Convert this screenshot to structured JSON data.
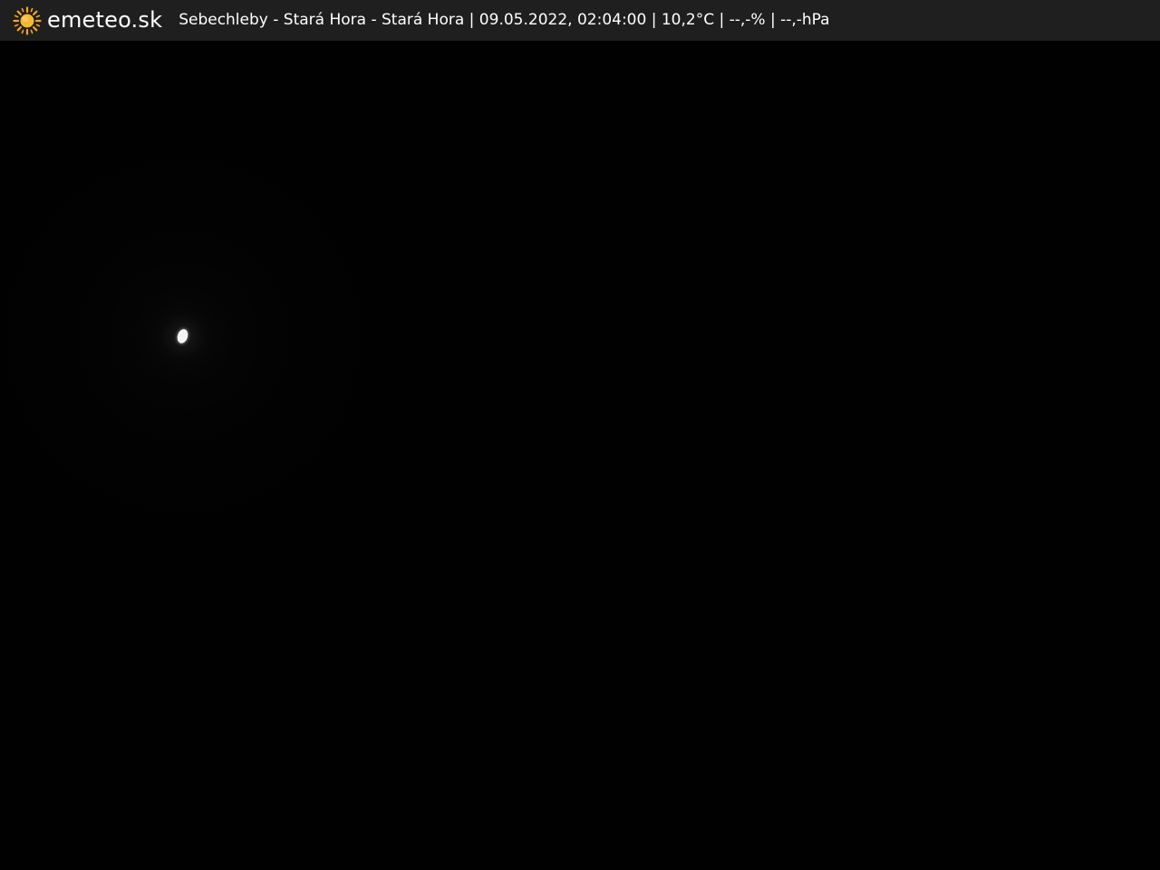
{
  "header": {
    "brand": "emeteo.sk",
    "logo_icon": "sun-icon",
    "caption": "Sebechleby - Stará Hora - Stará Hora | 09.05.2022, 02:04:00 | 10,2°C | --,-% | --,-hPa"
  },
  "colors": {
    "header_bg": "#1f1f1f",
    "sun": "#f5a623",
    "text": "#ffffff",
    "scene_bg": "#010101"
  }
}
